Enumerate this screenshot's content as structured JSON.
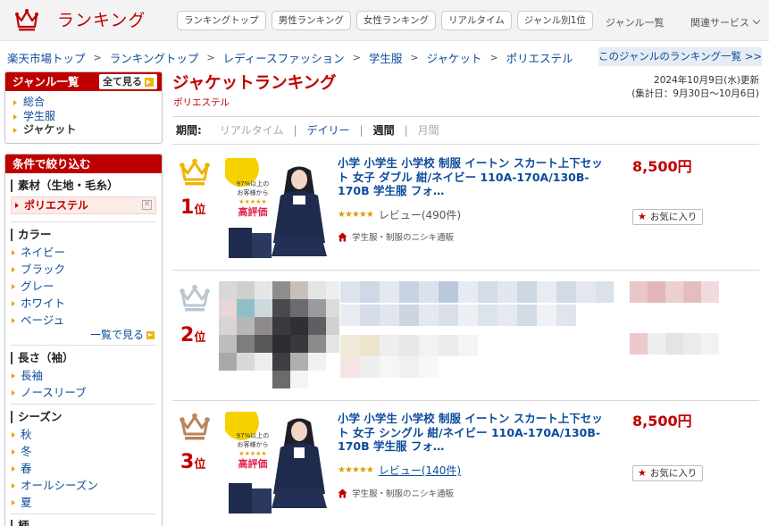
{
  "header": {
    "logo_text": "ランキング",
    "nav": [
      "ランキングトップ",
      "男性ランキング",
      "女性ランキング",
      "リアルタイム",
      "ジャンル別1位"
    ],
    "genre_list": "ジャンル一覧",
    "related_services": "関連サービス"
  },
  "breadcrumb": [
    "楽天市場トップ",
    "ランキングトップ",
    "レディースファッション",
    "学生服",
    "ジャケット",
    "ポリエステル"
  ],
  "genre_ranking_list": "このジャンルのランキング一覧 >>",
  "sidebar": {
    "genre": {
      "title": "ジャンル一覧",
      "see_all": "全て見る",
      "items": [
        "総合",
        "学生服",
        "ジャケット"
      ]
    },
    "filter": {
      "title": "条件で絞り込む",
      "material": {
        "title": "素材（生地・毛糸）",
        "selected": "ポリエステル"
      },
      "color": {
        "title": "カラー",
        "items": [
          "ネイビー",
          "ブラック",
          "グレー",
          "ホワイト",
          "ベージュ"
        ],
        "more": "一覧で見る"
      },
      "sleeve": {
        "title": "長さ（袖）",
        "items": [
          "長袖",
          "ノースリーブ"
        ]
      },
      "season": {
        "title": "シーズン",
        "items": [
          "秋",
          "冬",
          "春",
          "オールシーズン",
          "夏"
        ]
      },
      "next_title": "柄"
    }
  },
  "main": {
    "title": "ジャケットランキング",
    "subtitle": "ポリエステル",
    "updated": "2024年10月9日(水)更新",
    "period_range": "(集計日：9月30日〜10月6日)",
    "period": {
      "label": "期間:",
      "options": [
        "リアルタイム",
        "デイリー",
        "週間",
        "月間"
      ],
      "active": "週間"
    }
  },
  "items": [
    {
      "rank": "1",
      "rank_suffix": "位",
      "title": "小学 小学生 小学校 制服 イートン スカート上下セット 女子 ダブル 紺/ネイビー 110A-170A/130B-170B 学生服 フォ…",
      "rating": "★★★★★",
      "review": "レビュー(490件)",
      "shop": "学生服・制服のニシキ通販",
      "price": "8,500円",
      "favorite": "お気に入り",
      "badge_lines": [
        "97%以上の",
        "お客様から",
        "★★★★★",
        "高評価"
      ]
    },
    {
      "rank": "2",
      "rank_suffix": "位"
    },
    {
      "rank": "3",
      "rank_suffix": "位",
      "title": "小学 小学生 小学校 制服 イートン スカート上下セット 女子 シングル 紺/ネイビー 110A-170A/130B-170B 学生服 フォ…",
      "rating": "★★★★★",
      "review": "レビュー(140件)",
      "shop": "学生服・制服のニシキ通販",
      "price": "8,500円",
      "favorite": "お気に入り",
      "badge_lines": [
        "97%以上の",
        "お客様から",
        "★★★★★",
        "高評価"
      ]
    }
  ],
  "colors": {
    "brand_red": "#bf0000",
    "link_blue": "#0c4b9b",
    "gold": "#e0a400",
    "crown_gold": "#f1b400",
    "crown_silver": "#b9c7d3",
    "crown_bronze": "#b8865a"
  }
}
